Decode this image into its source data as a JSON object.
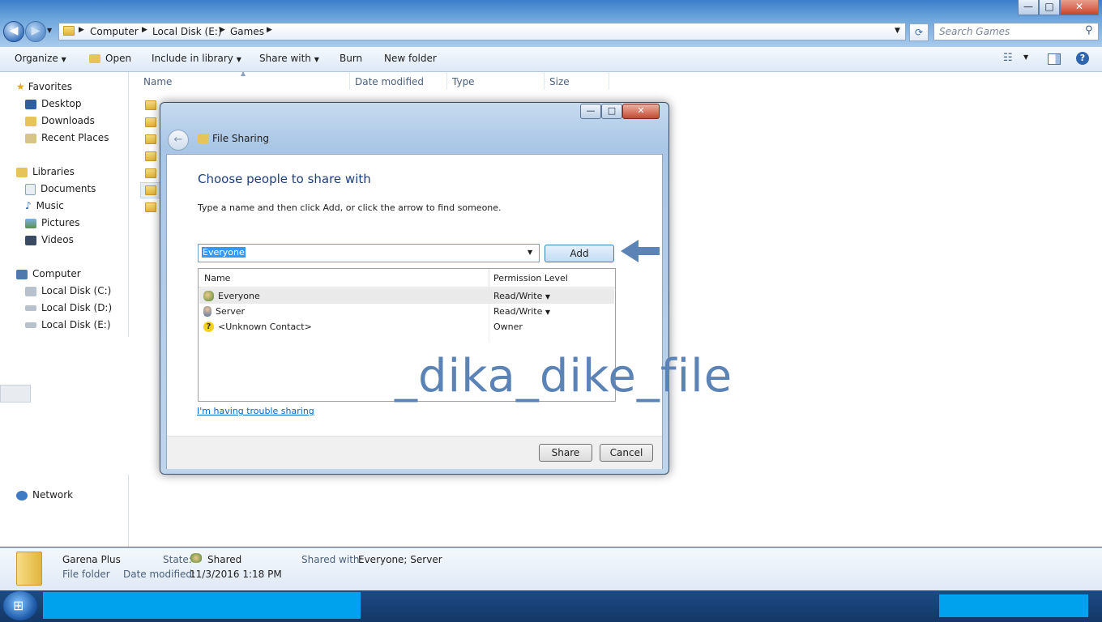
{
  "window": {
    "minimize": "—",
    "maximize": "□",
    "close": "✕"
  },
  "address": {
    "crumbs": [
      "Computer",
      "Local Disk (E:)",
      "Games"
    ],
    "search_placeholder": "Search Games"
  },
  "toolbar": {
    "organize": "Organize",
    "open": "Open",
    "include_in_library": "Include in library",
    "share_with": "Share with",
    "burn": "Burn",
    "new_folder": "New folder"
  },
  "nav": {
    "favorites": "Favorites",
    "desktop": "Desktop",
    "downloads": "Downloads",
    "recent_places": "Recent Places",
    "libraries": "Libraries",
    "documents": "Documents",
    "music": "Music",
    "pictures": "Pictures",
    "videos": "Videos",
    "computer": "Computer",
    "disk_c": "Local Disk (C:)",
    "disk_d": "Local Disk (D:)",
    "disk_e": "Local Disk (E:)",
    "network": "Network"
  },
  "columns": {
    "name": "Name",
    "date_modified": "Date modified",
    "type": "Type",
    "size": "Size"
  },
  "dialog": {
    "title": "File Sharing",
    "heading": "Choose people to share with",
    "instructions": "Type a name and then click Add, or click the arrow to find someone.",
    "input_value": "Everyone",
    "add_button": "Add",
    "col_name": "Name",
    "col_permission": "Permission Level",
    "rows": [
      {
        "name": "Everyone",
        "permission": "Read/Write"
      },
      {
        "name": "Server",
        "permission": "Read/Write"
      },
      {
        "name": "<Unknown Contact>",
        "permission": "Owner"
      }
    ],
    "trouble_link": "I'm having trouble sharing",
    "share_button": "Share",
    "cancel_button": "Cancel"
  },
  "watermark": "_dika_dike_file",
  "details": {
    "name": "Garena Plus",
    "kind": "File folder",
    "state_label": "State:",
    "state_value": "Shared",
    "modified_label": "Date modified:",
    "modified_value": "11/3/2016 1:18 PM",
    "shared_with_label": "Shared with:",
    "shared_with_value": "Everyone; Server"
  },
  "colors": {
    "accent": "#2a6db3",
    "heading": "#1e3f7a",
    "link": "#0066cc",
    "arrow": "#5b83b6"
  }
}
